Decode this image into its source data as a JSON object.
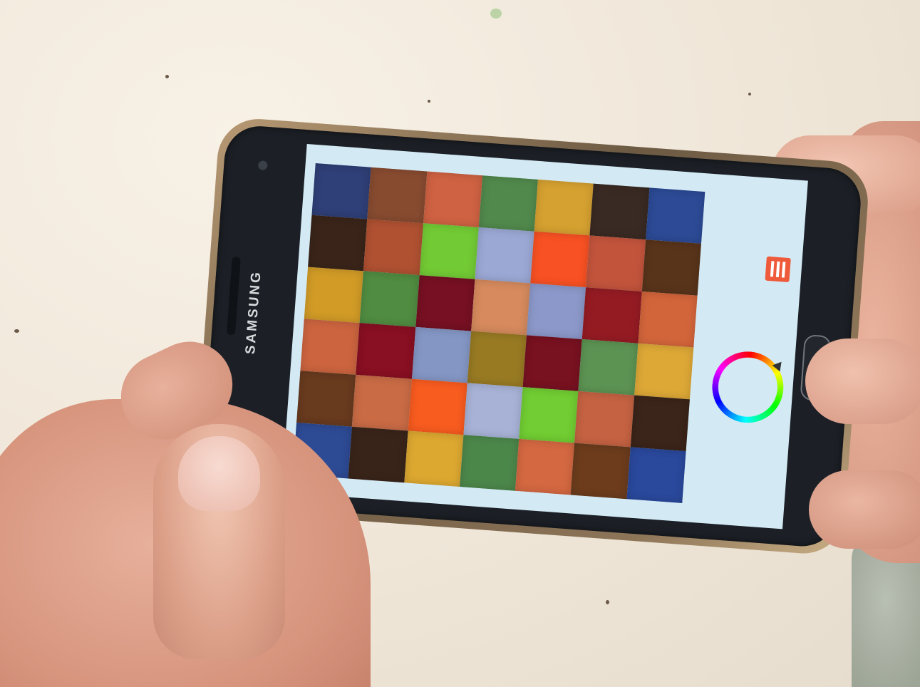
{
  "phone": {
    "brand": "SAMSUNG"
  },
  "app": {
    "menu_icon": "hamburger-menu-icon",
    "color_wheel_icon": "hue-ring-icon",
    "accent_color": "#ee5a3a",
    "screen_background": "#d3eaf5"
  },
  "mosaic": {
    "rows": 6,
    "columns": 7,
    "tiles": [
      [
        "#2e3f7a",
        "#8a4a2e",
        "#d3613f",
        "#4f8a4a",
        "#d8a12a",
        "#3a2a22",
        "#2b4a9a"
      ],
      [
        "#3b2418",
        "#b4502f",
        "#6fcc2e",
        "#9aa8d6",
        "#ff4f1f",
        "#c8533a",
        "#5a3418"
      ],
      [
        "#d49b20",
        "#4e8d3e",
        "#7a0f22",
        "#d9895a",
        "#8a98cc",
        "#9a1a22",
        "#d86438"
      ],
      [
        "#d0633c",
        "#8e0e22",
        "#8396c6",
        "#9a7a1e",
        "#7c1020",
        "#5a9450",
        "#e0a830"
      ],
      [
        "#6a3a1c",
        "#cd6a42",
        "#ff5a1a",
        "#a6b2d8",
        "#6ecf2c",
        "#c9613f",
        "#3c2418"
      ],
      [
        "#2c4a98",
        "#3a2418",
        "#e0a82a",
        "#4a8848",
        "#d8673e",
        "#6e3c1a",
        "#2848a0"
      ]
    ]
  }
}
